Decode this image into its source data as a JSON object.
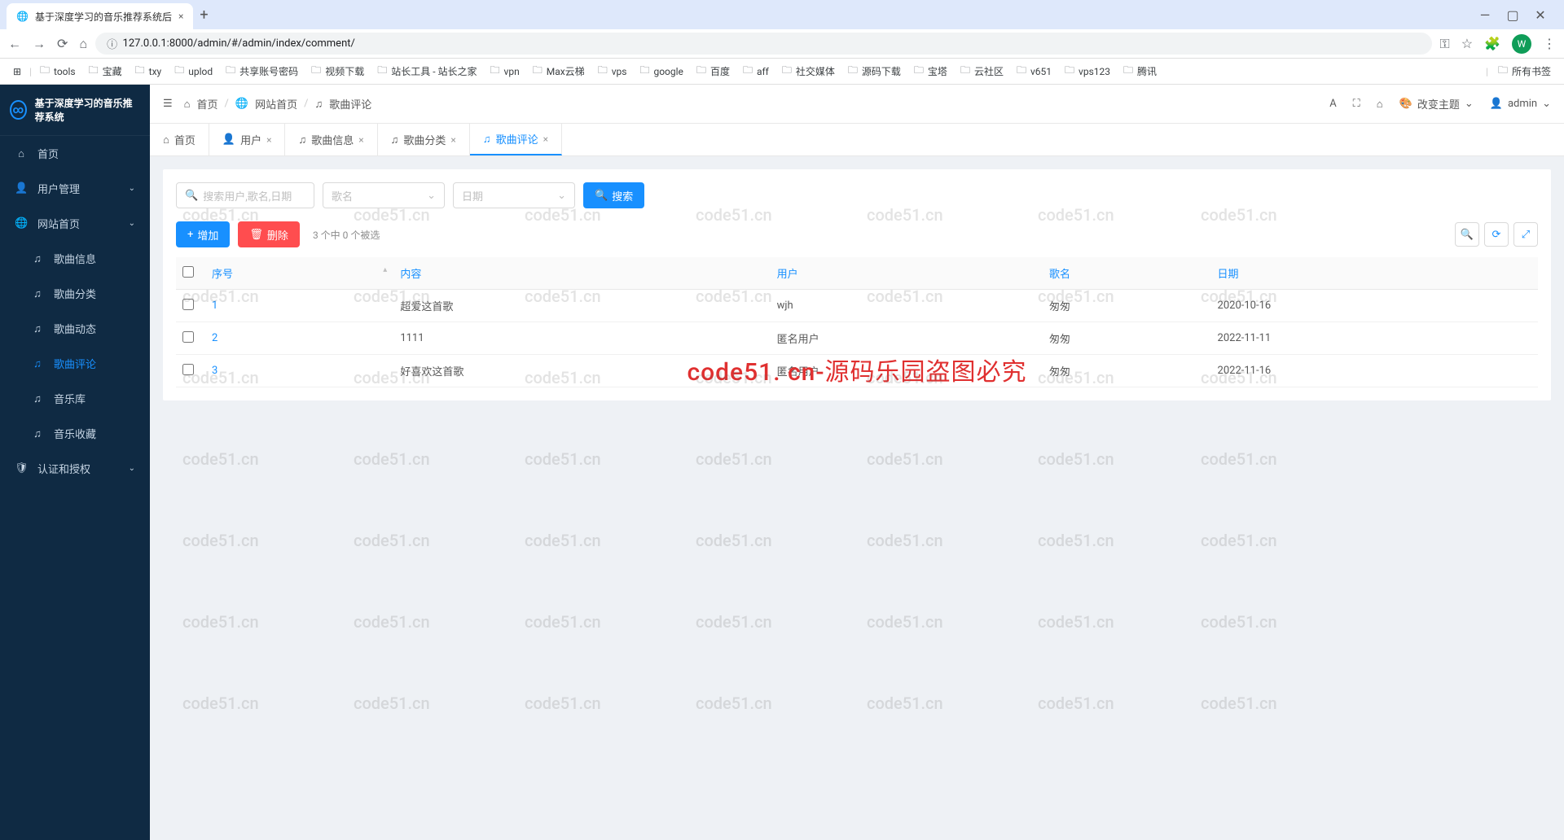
{
  "browser": {
    "tab_title": "基于深度学习的音乐推荐系统后",
    "url": "127.0.0.1:8000/admin/#/admin/index/comment/",
    "avatar_letter": "W"
  },
  "bookmarks": [
    "tools",
    "宝藏",
    "txy",
    "uplod",
    "共享账号密码",
    "视频下载",
    "站长工具 - 站长之家",
    "vpn",
    "Max云梯",
    "vps",
    "google",
    "百度",
    "aff",
    "社交媒体",
    "源码下载",
    "宝塔",
    "云社区",
    "v651",
    "vps123",
    "腾讯"
  ],
  "bookmarks_all": "所有书签",
  "app": {
    "title": "基于深度学习的音乐推荐系统",
    "user": "admin",
    "change_theme": "改变主题"
  },
  "sidebar": {
    "home": "首页",
    "user_mgmt": "用户管理",
    "site_home": "网站首页",
    "song_info": "歌曲信息",
    "song_category": "歌曲分类",
    "song_dynamic": "歌曲动态",
    "song_comment": "歌曲评论",
    "music_lib": "音乐库",
    "music_fav": "音乐收藏",
    "auth": "认证和授权"
  },
  "breadcrumb": {
    "home": "首页",
    "site": "网站首页",
    "current": "歌曲评论"
  },
  "tabs": [
    {
      "icon": "home",
      "label": "首页",
      "closable": false
    },
    {
      "icon": "user",
      "label": "用户",
      "closable": true
    },
    {
      "icon": "music",
      "label": "歌曲信息",
      "closable": true
    },
    {
      "icon": "music",
      "label": "歌曲分类",
      "closable": true
    },
    {
      "icon": "music",
      "label": "歌曲评论",
      "closable": true,
      "active": true
    }
  ],
  "filters": {
    "search_placeholder": "搜索用户,歌名,日期",
    "select1_placeholder": "歌名",
    "select2_placeholder": "日期",
    "search_btn": "搜索"
  },
  "actions": {
    "add": "增加",
    "delete": "删除",
    "selection_info": "3 个中 0 个被选"
  },
  "table": {
    "columns": {
      "seq": "序号",
      "content": "内容",
      "user": "用户",
      "song": "歌名",
      "date": "日期"
    },
    "rows": [
      {
        "seq": "1",
        "content": "超爱这首歌",
        "user": "wjh",
        "song": "匆匆",
        "date": "2020-10-16"
      },
      {
        "seq": "2",
        "content": "1111",
        "user": "匿名用户",
        "song": "匆匆",
        "date": "2022-11-11"
      },
      {
        "seq": "3",
        "content": "好喜欢这首歌",
        "user": "匿名用户",
        "song": "匆匆",
        "date": "2022-11-16"
      }
    ]
  },
  "watermark": {
    "small": "code51.cn",
    "big": "code51. cn-源码乐园盗图必究"
  }
}
